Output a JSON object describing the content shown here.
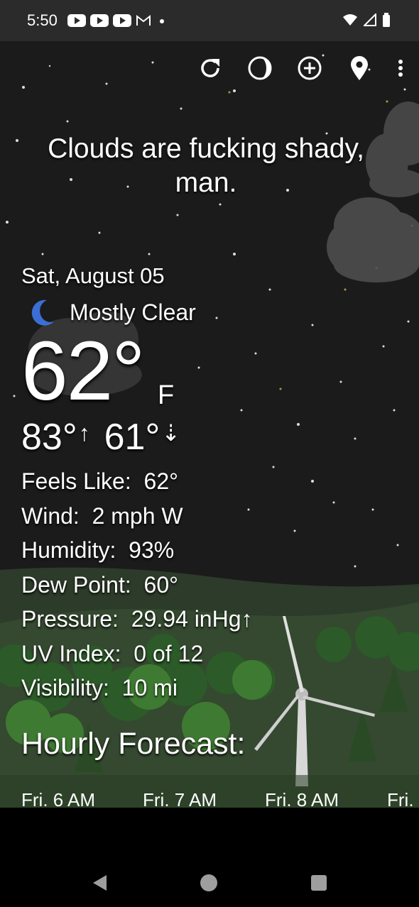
{
  "status": {
    "time": "5:50",
    "left_icons": [
      "youtube-icon",
      "youtube-icon",
      "youtube-icon",
      "gmail-icon",
      "dot-icon"
    ],
    "right_icons": [
      "wifi-icon",
      "signal-icon",
      "battery-icon"
    ]
  },
  "toolbar": {
    "icons": [
      "refresh-icon",
      "moon-phase-icon",
      "add-location-icon",
      "location-pin-icon",
      "more-vert-icon"
    ]
  },
  "headline": "Clouds are fucking shady, man.",
  "current": {
    "date": "Sat, August 05",
    "condition": "Mostly Clear",
    "condition_icon": "moon-icon",
    "temp": "62°",
    "unit": "F",
    "high": "83°",
    "low": "61°"
  },
  "details": [
    {
      "label": "Feels Like:",
      "value": "62°"
    },
    {
      "label": "Wind:",
      "value": "2 mph W"
    },
    {
      "label": "Humidity:",
      "value": "93%"
    },
    {
      "label": "Dew Point:",
      "value": "60°"
    },
    {
      "label": "Pressure:",
      "value": "29.94 inHg↑"
    },
    {
      "label": "UV Index:",
      "value": "0 of 12"
    },
    {
      "label": "Visibility:",
      "value": "10 mi"
    }
  ],
  "hourly": {
    "title": "Hourly Forecast:",
    "items": [
      "Fri. 6 AM",
      "Fri. 7 AM",
      "Fri. 8 AM",
      "Fri."
    ]
  },
  "colors": {
    "status_bar": "#2b2b2b",
    "sky": "#1b1b1b",
    "moon": "#3b6fd6",
    "grass": "#3d5a35"
  }
}
